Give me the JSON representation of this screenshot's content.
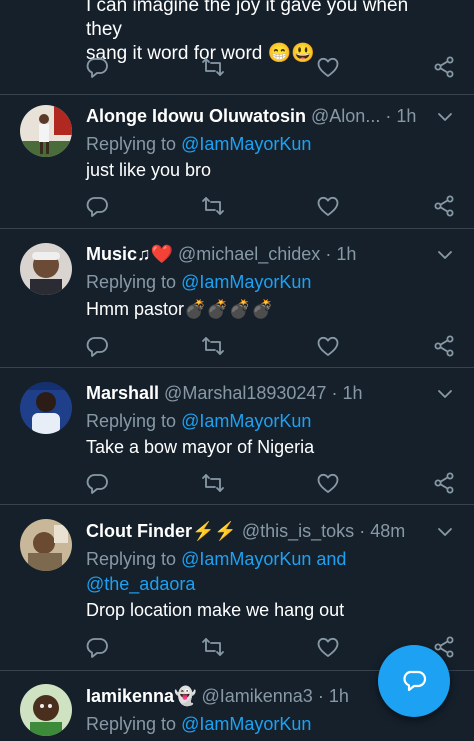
{
  "partial_tweet": {
    "line1": "I can imagine the joy it gave you when they",
    "line2": "sang it word for word",
    "emojis": "😁😃"
  },
  "tweets": [
    {
      "name": "Alonge Idowu Oluwatosin",
      "name_emoji": "",
      "handle": "@Alon...",
      "time": "1h",
      "replying_prefix": "Replying to ",
      "mention1": "@IamMayorKun",
      "mention2": "",
      "and_text": "",
      "body": "just like you bro",
      "body_emoji": ""
    },
    {
      "name": "Music♫",
      "name_emoji": "❤️",
      "handle": "@michael_chidex",
      "time": "1h",
      "replying_prefix": "Replying to ",
      "mention1": "@IamMayorKun",
      "mention2": "",
      "and_text": "",
      "body": "Hmm pastor",
      "body_emoji": "💣💣💣💣"
    },
    {
      "name": "Marshall",
      "name_emoji": "",
      "handle": "@Marshal18930247",
      "time": "1h",
      "replying_prefix": "Replying to ",
      "mention1": "@IamMayorKun",
      "mention2": "",
      "and_text": "",
      "body": "Take a bow mayor of Nigeria",
      "body_emoji": ""
    },
    {
      "name": "Clout Finder",
      "name_emoji": "⚡⚡",
      "handle": "@this_is_toks",
      "time": "48m",
      "replying_prefix": "Replying to ",
      "mention1": "@IamMayorKun",
      "and_text": " and",
      "mention2": "@the_adaora",
      "body": "Drop location make we hang out",
      "body_emoji": ""
    },
    {
      "name": "Iamikenna",
      "name_emoji": "👻",
      "handle": "@Iamikenna3",
      "time": "1h",
      "replying_prefix": "Replying to ",
      "mention1": "@IamMayorKun",
      "mention2": "",
      "and_text": "",
      "body": "",
      "body_emoji": ""
    }
  ],
  "separator": "·",
  "icons": {
    "reply": "reply-icon",
    "retweet": "retweet-icon",
    "like": "heart-icon",
    "share": "share-icon",
    "caret": "chevron-down-icon",
    "compose": "new-message-icon"
  },
  "colors": {
    "background": "#15202b",
    "accent": "#1da1f2",
    "secondary_text": "#8899a6",
    "divider": "#38444d"
  }
}
